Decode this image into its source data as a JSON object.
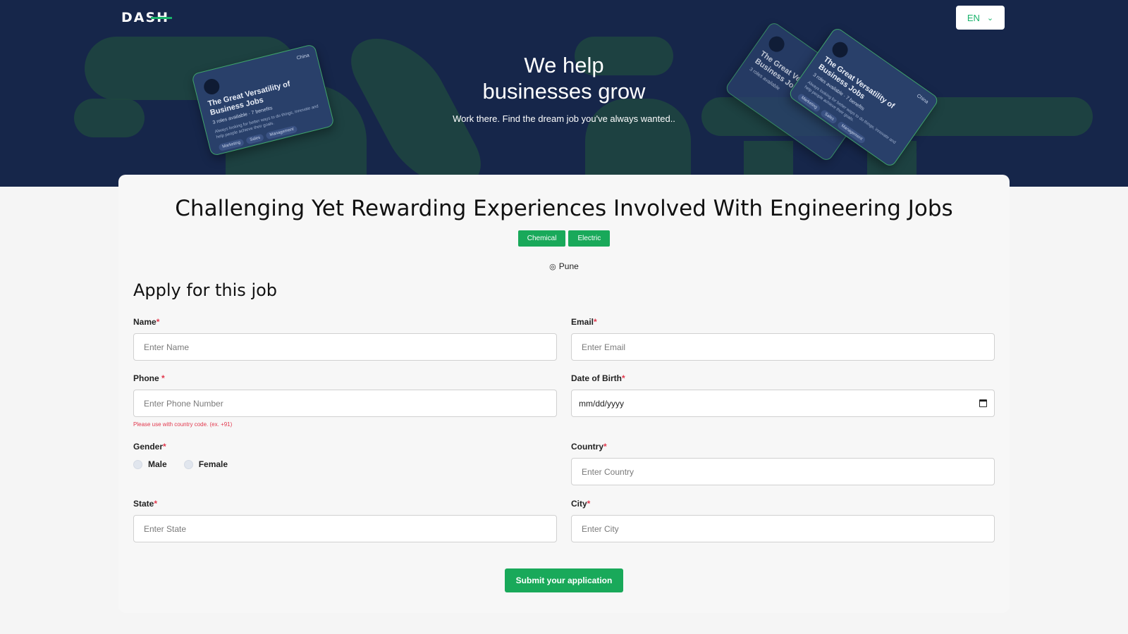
{
  "brand": {
    "logo_text": "DASH",
    "accent": "#19a95a",
    "hero_bg": "#16264a"
  },
  "language": {
    "selected": "EN",
    "icon": "chevron-down-icon"
  },
  "hero": {
    "title_line1": "We help",
    "title_line2": "businesses grow",
    "subtitle": "Work there. Find the dream job you've always wanted.."
  },
  "decor_card": {
    "title": "The Great Versatility of Business Jobs",
    "roles": "3 roles available",
    "benefits": "7 benefits",
    "description": "Always looking for better ways to do things, innovate and help people achieve their goals.",
    "location": "China",
    "tags": [
      "Marketing",
      "Sales",
      "Management"
    ]
  },
  "job": {
    "title": "Challenging Yet Rewarding Experiences Involved With Engineering Jobs",
    "tags": [
      "Chemical",
      "Electric"
    ],
    "location": "Pune"
  },
  "form": {
    "heading": "Apply for this job",
    "name": {
      "label": "Name",
      "placeholder": "Enter Name"
    },
    "email": {
      "label": "Email",
      "placeholder": "Enter Email"
    },
    "phone": {
      "label": "Phone ",
      "placeholder": "Enter Phone Number",
      "hint": "Please use with country code. (ex. +91)"
    },
    "dob": {
      "label": "Date of Birth",
      "placeholder": "mm/dd/yyyy"
    },
    "gender": {
      "label": "Gender",
      "options": [
        "Male",
        "Female"
      ]
    },
    "country": {
      "label": "Country",
      "placeholder": "Enter Country"
    },
    "state": {
      "label": "State",
      "placeholder": "Enter State"
    },
    "city": {
      "label": "City",
      "placeholder": "Enter City"
    },
    "required_mark": "*",
    "submit_label": "Submit your application"
  }
}
